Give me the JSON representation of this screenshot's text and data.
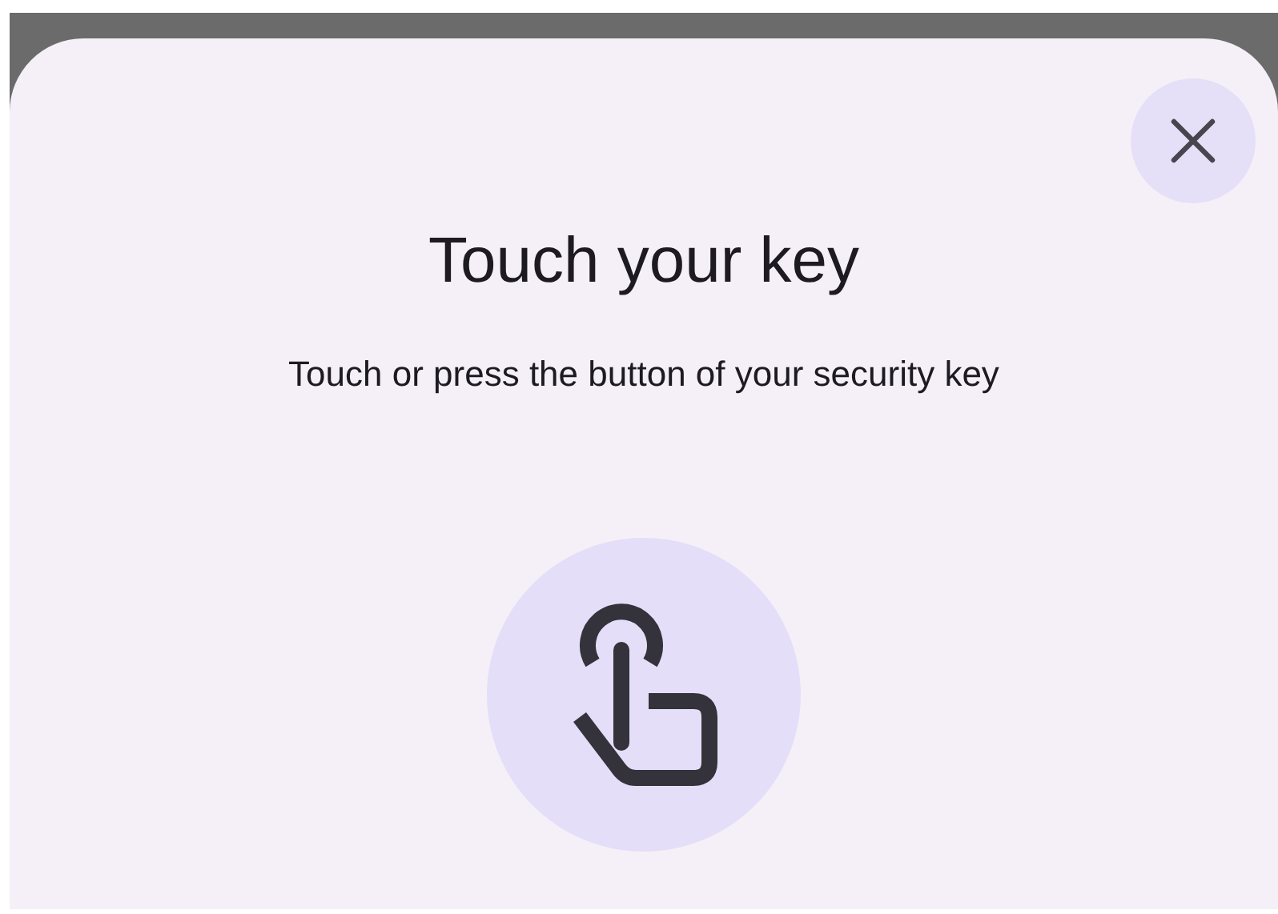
{
  "dialog": {
    "title": "Touch your key",
    "message": "Touch or press the button of your security key"
  }
}
